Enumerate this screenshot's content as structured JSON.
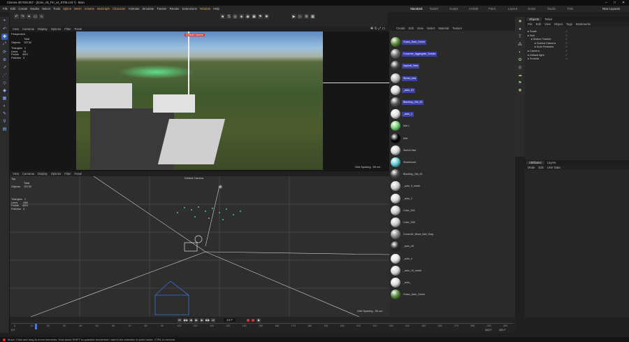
{
  "window": {
    "title": "Cinema 4D R25.057 - [Zone_Alt_Fin_v4_0709.c4d *] - Main"
  },
  "menu": [
    "File",
    "Edit",
    "Create",
    "Modes",
    "Select",
    "Tools",
    "Spline",
    "Mesh",
    "Volume",
    "MoGraph",
    "Character",
    "Animate",
    "Simulate",
    "Tracker",
    "Render",
    "Extensions",
    "Window",
    "Help"
  ],
  "layouts": {
    "items": [
      "Standard",
      "Model",
      "Sculpt",
      "UVEdit",
      "Paint",
      "Layout",
      "Script",
      "Studio",
      "Ti4D"
    ],
    "new_layouts": "New Layouts"
  },
  "viewport_top": {
    "menu": [
      "View",
      "Cameras",
      "Display",
      "Options",
      "Filter",
      "Panel"
    ],
    "projection": "Perspective",
    "hud": {
      "total_label": "Total",
      "objects_label": "Objects",
      "objects_value": "33732",
      "triangles_label": "Triangles",
      "triangles_value": "1",
      "lines_label": "Lines",
      "lines_value": "81",
      "points_label": "Points",
      "points_value": "4001",
      "patches_label": "Patches",
      "patches_value": "0"
    },
    "camera_label": "Default Camera",
    "grid_spacing": "Grid Spacing : 50 cm"
  },
  "viewport_bottom": {
    "menu": [
      "View",
      "Cameras",
      "Display",
      "Options",
      "Filter",
      "Panel"
    ],
    "projection": "Top",
    "camera_label": "Default Camera",
    "hud": {
      "total_label": "Total",
      "objects_label": "Objects",
      "objects_value": "33732",
      "triangles_label": "Triangles",
      "triangles_value": "1",
      "lines_label": "Lines",
      "lines_value": "886",
      "points_label": "Points",
      "points_value": "4001",
      "patches_label": "Patches",
      "patches_value": "0"
    },
    "grid_spacing": "Grid Spacing : 50 cm"
  },
  "material_manager": {
    "menu": [
      "Create",
      "Edit",
      "View",
      "Select",
      "Material",
      "Texture"
    ],
    "materials": [
      {
        "name": "Grass_Dark_Green",
        "color": "#5a8a3c",
        "selected": true
      },
      {
        "name": "Concrete_Aggregate_Smoke",
        "color": "#6e6e6e",
        "selected": true
      },
      {
        "name": "Asphalt_New",
        "color": "#444444",
        "selected": true
      },
      {
        "name": "Street_new",
        "color": "#bbbbbb",
        "selected": true
      },
      {
        "name": "_auto_01",
        "color": "#dddddd",
        "selected": true
      },
      {
        "name": "Blacktop_Old_02",
        "color": "#555555",
        "selected": true
      },
      {
        "name": "_auto_1",
        "color": "#e0e0e0",
        "selected": true
      },
      {
        "name": "Mat 1",
        "color": "#74d476",
        "selected": false
      },
      {
        "name": "Mat",
        "color": "#050505",
        "selected": false
      },
      {
        "name": "Sketch Mat",
        "color": "#d8d8d8",
        "selected": false
      },
      {
        "name": "Shadowcat",
        "color": "#5fd0d8",
        "selected": false
      },
      {
        "name": "Blacktop_Old_02",
        "color": "#4a4a4a",
        "selected": false
      },
      {
        "name": "_auto_3_metal",
        "color": "#cfcfcf",
        "selected": false
      },
      {
        "name": "_auto_2",
        "color": "#dcdcdc",
        "selected": false
      },
      {
        "name": "Color_004",
        "color": "#d0d0d0",
        "selected": false
      },
      {
        "name": "Color_008",
        "color": "#cccccc",
        "selected": false
      },
      {
        "name": "Concrete_Block_Bell_Gray",
        "color": "#8a8a8a",
        "selected": false
      },
      {
        "name": "_auto_05",
        "color": "#2b2b2b",
        "selected": false
      },
      {
        "name": "_auto_4",
        "color": "#e3e3e3",
        "selected": false
      },
      {
        "name": "_auto_10_metal",
        "color": "#d6d6d6",
        "selected": false
      },
      {
        "name": "_auto_",
        "color": "#dddddd",
        "selected": false
      },
      {
        "name": "Grass_Dark_Green",
        "color": "#5a8a3c",
        "selected": false
      }
    ]
  },
  "object_manager": {
    "tabs": [
      "Objects",
      "Takes"
    ],
    "menu": [
      "File",
      "Edit",
      "View",
      "Object",
      "Tags",
      "Bookmarks"
    ],
    "rows": [
      {
        "name": "Scale",
        "indent": 0
      },
      {
        "name": "Null",
        "indent": 0
      },
      {
        "name": "Motion Tracker",
        "indent": 1
      },
      {
        "name": "Solved Camera",
        "indent": 2
      },
      {
        "name": "Auto Features",
        "indent": 2
      },
      {
        "name": "Camera",
        "indent": 0
      },
      {
        "name": "Default light",
        "indent": 0
      },
      {
        "name": "Zone4d",
        "indent": 0
      }
    ]
  },
  "attributes": {
    "tabs": [
      "Attributes",
      "Layers"
    ],
    "menu": [
      "Mode",
      "Edit",
      "User Data"
    ]
  },
  "timeline": {
    "ticks": [
      "0",
      "10",
      "20",
      "30",
      "40",
      "50",
      "60",
      "70",
      "80",
      "90",
      "100",
      "110",
      "120",
      "130",
      "140",
      "150",
      "160",
      "170",
      "180",
      "190",
      "200",
      "210",
      "220",
      "230",
      "240",
      "250",
      "260",
      "270",
      "280",
      "290",
      "300"
    ],
    "current_frame": "13 F",
    "start_frame": "0 F",
    "end_frame": "300 F",
    "max_frame": "300 F",
    "playhead_value": 13
  },
  "status": {
    "text": "Move: Click and drag to move elements. Hold down SHIFT to quantize movement / add to the selection in point mode, CTRL to remove."
  }
}
